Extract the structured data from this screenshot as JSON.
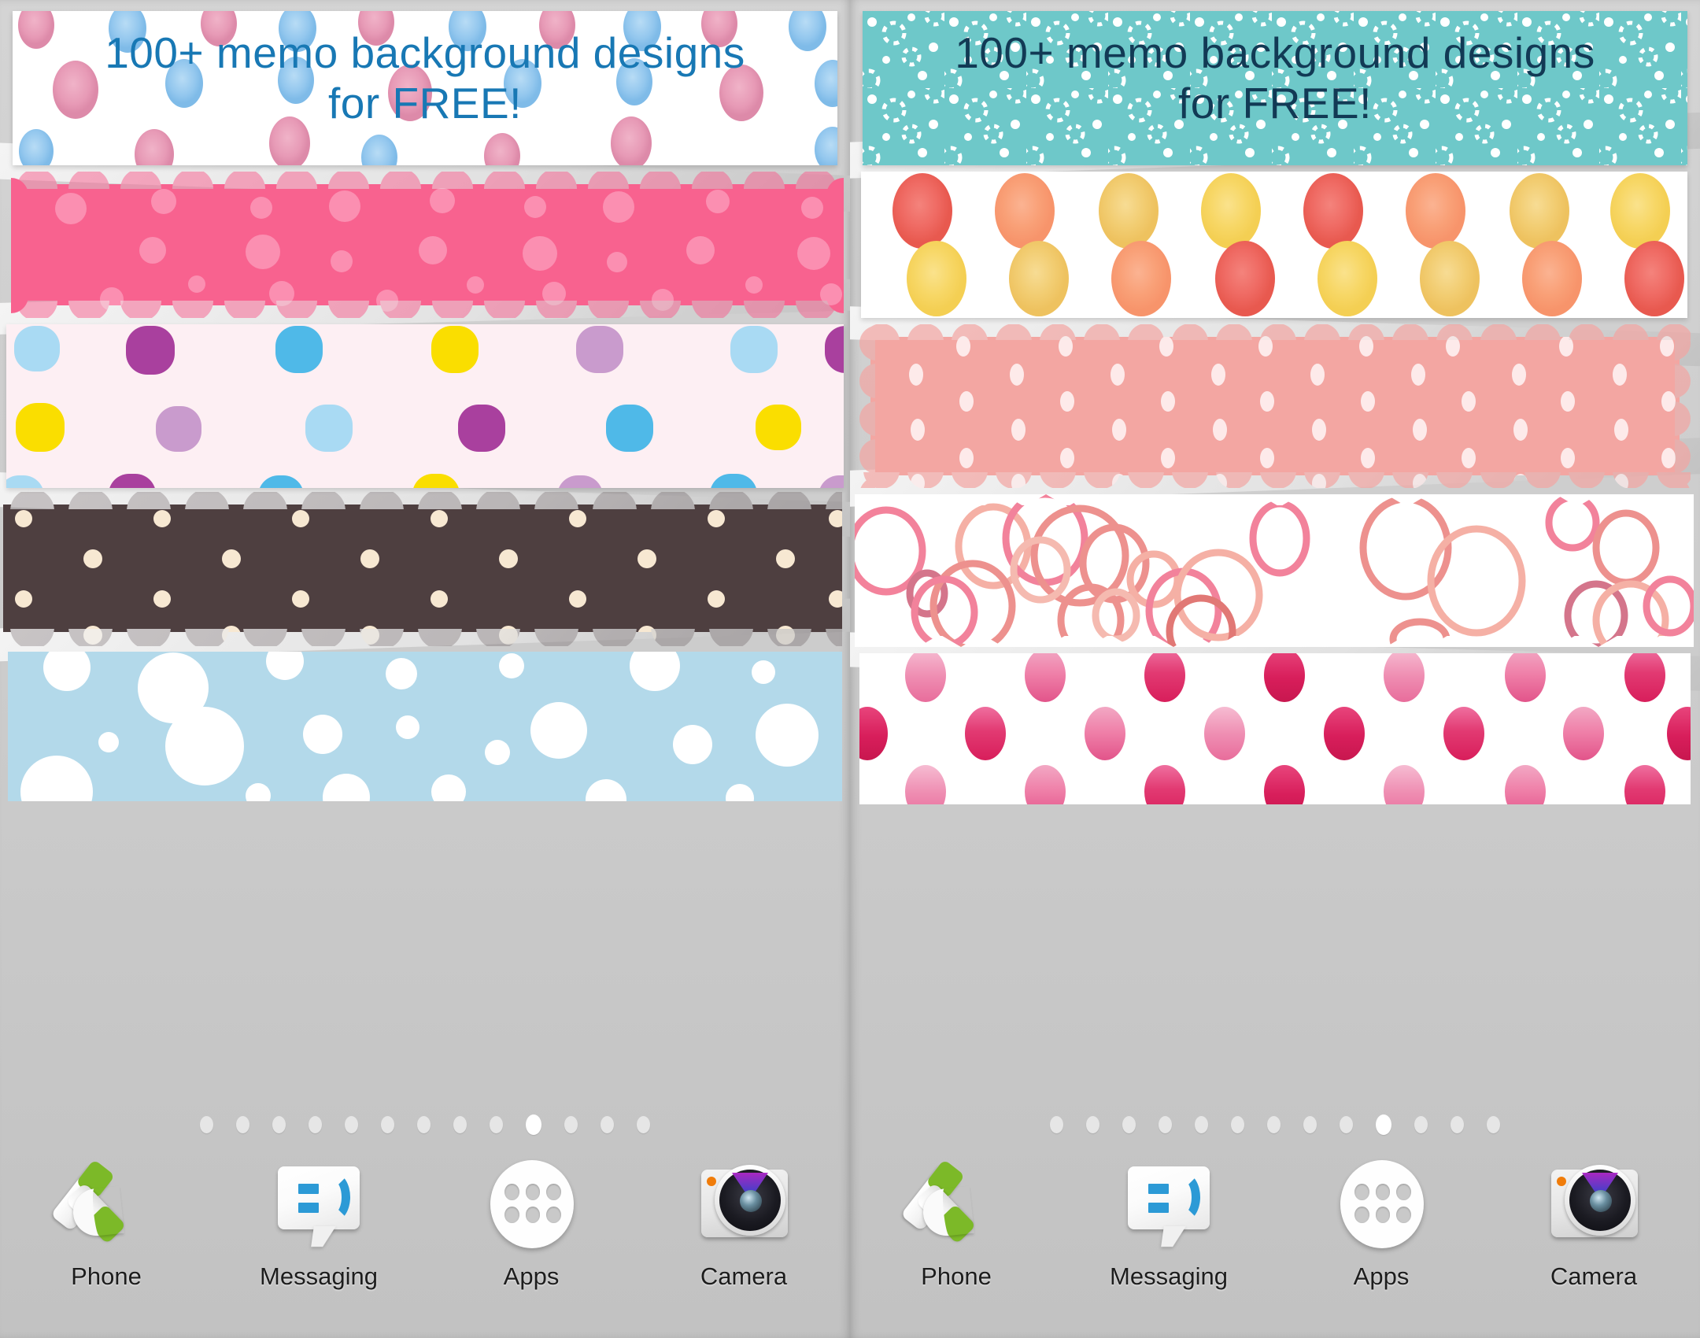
{
  "app": {
    "promo_line1": "100+ memo background designs",
    "promo_line2": "for FREE!"
  },
  "screens": [
    {
      "id": "left",
      "header": {
        "title_line1": "100+ memo background designs",
        "title_line2": "for FREE!",
        "text_color": "#1878b4",
        "background": "#ffffff",
        "pattern": "watercolor-dots-pink-blue"
      },
      "bands": [
        {
          "name": "header-watercolor-dots",
          "background": "#ffffff",
          "accent_colors": [
            "#e79ab6",
            "#8fc4ea"
          ]
        },
        {
          "name": "pink-scallop-dots",
          "background": "#f8628f",
          "accent_colors": [
            "#fa87a9",
            "#fb9dba"
          ]
        },
        {
          "name": "multicolor-polka-dots",
          "background": "#fdeff3",
          "accent_colors": [
            "#a9409e",
            "#4fb9e8",
            "#fade00",
            "#c99bcd",
            "#a9daf3"
          ]
        },
        {
          "name": "brown-cream-dots",
          "background": "#4e3f40",
          "accent_colors": [
            "#f7e8d2"
          ]
        },
        {
          "name": "blue-white-bubbles",
          "background": "#b3d9ea",
          "accent_colors": [
            "#ffffff"
          ]
        }
      ],
      "page_indicator": {
        "total": 13,
        "active_index": 9
      },
      "dock": [
        {
          "label": "Phone",
          "icon": "phone-icon"
        },
        {
          "label": "Messaging",
          "icon": "messaging-icon"
        },
        {
          "label": "Apps",
          "icon": "apps-grid-icon"
        },
        {
          "label": "Camera",
          "icon": "camera-icon"
        }
      ]
    },
    {
      "id": "right",
      "header": {
        "title_line1": "100+ memo background designs",
        "title_line2": "for FREE!",
        "text_color": "#123a55",
        "background": "#6ec8c9",
        "pattern": "teal-rings-and-dots"
      },
      "bands": [
        {
          "name": "teal-rings-header",
          "background": "#6ec8c9",
          "accent_colors": [
            "#ffffff"
          ]
        },
        {
          "name": "orange-watercolor-dots",
          "background": "#ffffff",
          "accent_colors": [
            "#ef6a63",
            "#f9a077",
            "#f3c768",
            "#f7d766"
          ]
        },
        {
          "name": "salmon-scallop-dots",
          "background": "#f3a6a2",
          "accent_colors": [
            "#fdeaea"
          ]
        },
        {
          "name": "coral-circle-outlines",
          "background": "#ffffff",
          "accent_colors": [
            "#e8736f",
            "#ef5f7f",
            "#f39a8c"
          ]
        },
        {
          "name": "magenta-watercolor-dots",
          "background": "#ffffff",
          "accent_colors": [
            "#d81e5b",
            "#ef7fa8",
            "#f2a8c4"
          ]
        }
      ],
      "page_indicator": {
        "total": 13,
        "active_index": 9
      },
      "dock": [
        {
          "label": "Phone",
          "icon": "phone-icon"
        },
        {
          "label": "Messaging",
          "icon": "messaging-icon"
        },
        {
          "label": "Apps",
          "icon": "apps-grid-icon"
        },
        {
          "label": "Camera",
          "icon": "camera-icon"
        }
      ]
    }
  ],
  "colors": {
    "wallpaper_gray": "#cfcfcf",
    "dock_label": "#1d1d1d",
    "page_dot_inactive": "#e6e6e6",
    "page_dot_active": "#ffffff"
  }
}
